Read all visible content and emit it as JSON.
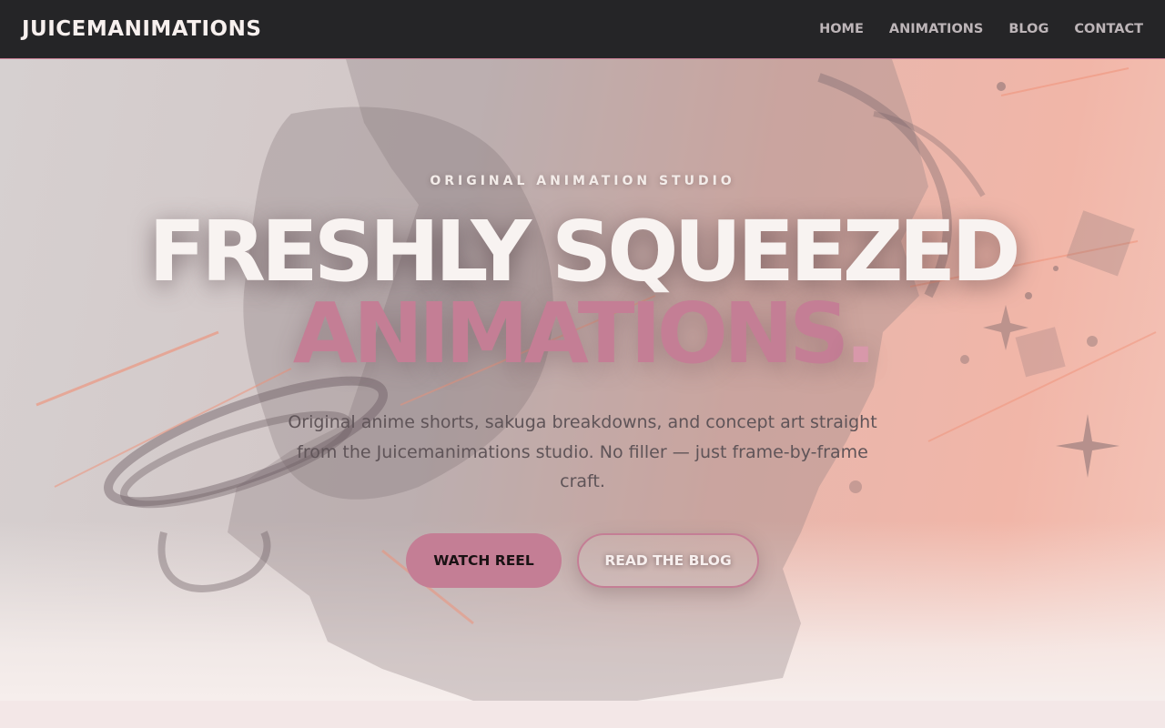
{
  "brand": {
    "name": "JUICEMANIMATIONS"
  },
  "nav": {
    "items": [
      {
        "label": "HOME"
      },
      {
        "label": "ANIMATIONS"
      },
      {
        "label": "BLOG"
      },
      {
        "label": "CONTACT"
      }
    ]
  },
  "hero": {
    "eyebrow": "ORIGINAL ANIMATION STUDIO",
    "headline_line1": "FRESHLY SQUEEZED",
    "headline_line2": "ANIMATIONS",
    "headline_dot": ".",
    "lede": "Original anime shorts, sakuga breakdowns, and concept art straight from the Juicemanimations studio. No filler — just frame-by-frame craft.",
    "primary_cta": "WATCH REEL",
    "secondary_cta": "READ THE BLOG"
  },
  "colors": {
    "nav_bg": "#252527",
    "accent": "#c47e95",
    "headline": "#f8f3f1",
    "body_text": "#5f5458",
    "page_bg": "#f3e7e7"
  }
}
